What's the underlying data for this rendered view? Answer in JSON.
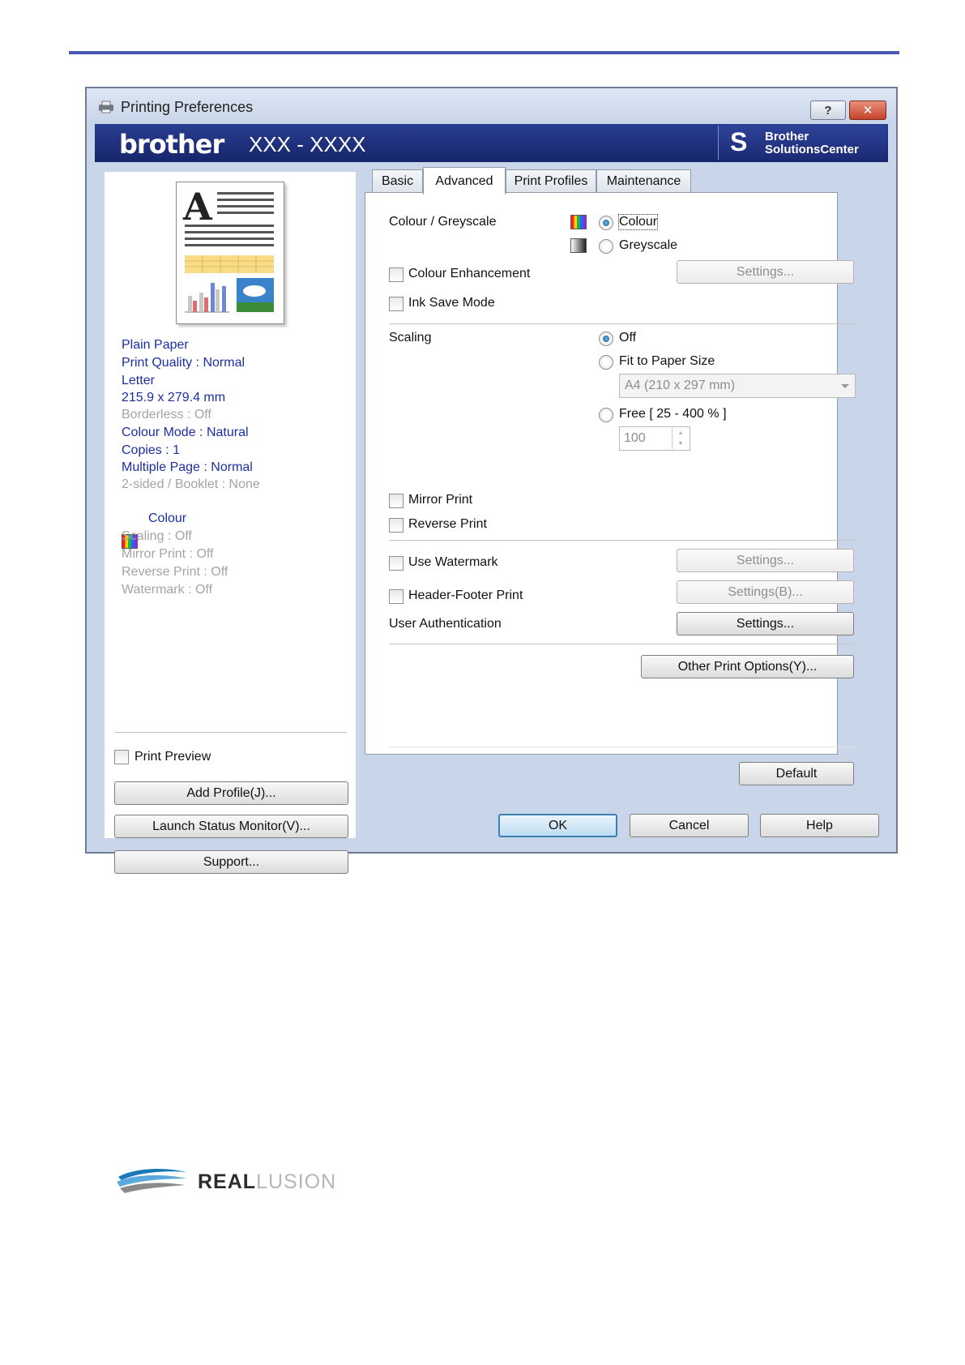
{
  "dialog": {
    "title": "Printing Preferences",
    "help_btn": "?",
    "close_btn": "✕",
    "brand": "brother",
    "model": "XXX - XXXX",
    "solutions_line1": "Brother",
    "solutions_line2": "SolutionsCenter"
  },
  "summary": {
    "paper": "Plain Paper",
    "quality": "Print Quality : Normal",
    "size": "Letter",
    "size_mm": "215.9 x 279.4 mm",
    "borderless": "Borderless : Off",
    "colour_mode": "Colour Mode : Natural",
    "copies": "Copies : 1",
    "multiple_page": "Multiple Page : Normal",
    "two_sided": "2-sided / Booklet : None",
    "colour": "Colour",
    "scaling": "Scaling : Off",
    "mirror": "Mirror Print : Off",
    "reverse": "Reverse Print : Off",
    "watermark": "Watermark : Off"
  },
  "left_controls": {
    "print_preview": "Print Preview",
    "add_profile": "Add Profile(J)...",
    "launch_status": "Launch Status Monitor(V)...",
    "support": "Support..."
  },
  "tabs": [
    "Basic",
    "Advanced",
    "Print Profiles",
    "Maintenance"
  ],
  "advanced": {
    "colour_greyscale_label": "Colour / Greyscale",
    "colour_option": "Colour",
    "greyscale_option": "Greyscale",
    "colour_enhancement": "Colour Enhancement",
    "enhancement_settings": "Settings...",
    "ink_save": "Ink Save Mode",
    "scaling_label": "Scaling",
    "scaling_off": "Off",
    "fit_to_paper": "Fit to Paper Size",
    "paper_size_value": "A4 (210 x 297 mm)",
    "free": "Free [ 25 - 400 % ]",
    "free_value": "100",
    "mirror_print": "Mirror Print",
    "reverse_print": "Reverse Print",
    "use_watermark": "Use Watermark",
    "watermark_settings": "Settings...",
    "header_footer": "Header-Footer Print",
    "header_footer_settings": "Settings(B)...",
    "user_auth": "User Authentication",
    "user_auth_settings": "Settings...",
    "other_options": "Other Print Options(Y)...",
    "default_btn": "Default"
  },
  "footer_buttons": {
    "ok": "OK",
    "cancel": "Cancel",
    "help": "Help"
  },
  "logo": {
    "part1": "REAL",
    "part2": "LUSION"
  }
}
